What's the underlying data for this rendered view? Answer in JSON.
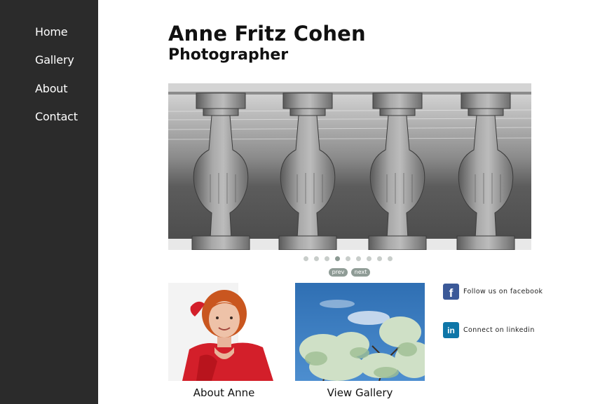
{
  "sidebar": {
    "items": [
      {
        "label": "Home"
      },
      {
        "label": "Gallery"
      },
      {
        "label": "About"
      },
      {
        "label": "Contact"
      }
    ]
  },
  "header": {
    "title": "Anne Fritz Cohen",
    "subtitle": "Photographer"
  },
  "slideshow": {
    "image": "black-and-white-balustrade-beach-photo",
    "slide_count": 9,
    "active_slide": 4,
    "prev_label": "prev",
    "next_label": "next"
  },
  "tiles": [
    {
      "image": "portrait-woman-red-dress",
      "caption": "About Anne"
    },
    {
      "image": "tree-branches-blue-sky",
      "caption": "View Gallery"
    }
  ],
  "social": [
    {
      "icon": "facebook-icon",
      "text": "Follow us on facebook",
      "color": "#3b5998"
    },
    {
      "icon": "linkedin-icon",
      "text": "Connect on linkedin",
      "color": "#0e76a8"
    }
  ],
  "colors": {
    "sidebar_bg": "#2b2b2b",
    "dot_inactive": "#c8cdca",
    "dot_active": "#8c9a93",
    "pager_button": "#8f9c96"
  }
}
